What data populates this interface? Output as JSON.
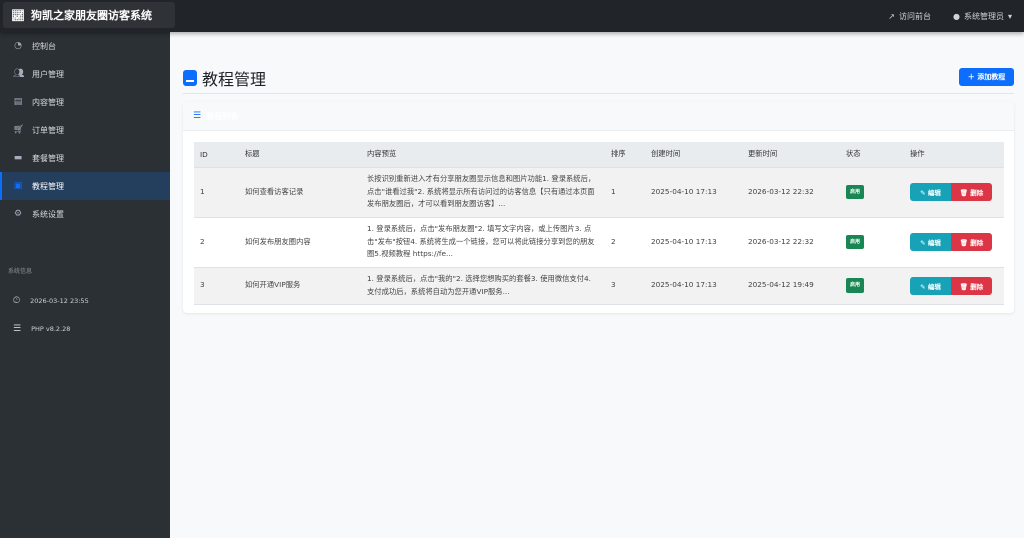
{
  "app": {
    "title": "狗凯之家朋友圈访客系统"
  },
  "navbar": {
    "visit_front": "访问前台",
    "user": "系统管理员"
  },
  "sidebar": {
    "items": [
      {
        "label": "控制台",
        "icon": "tachometer-icon"
      },
      {
        "label": "用户管理",
        "icon": "users-icon"
      },
      {
        "label": "内容管理",
        "icon": "file-icon"
      },
      {
        "label": "订单管理",
        "icon": "cart-icon"
      },
      {
        "label": "套餐管理",
        "icon": "box-icon"
      },
      {
        "label": "教程管理",
        "icon": "book-icon",
        "active": true
      },
      {
        "label": "系统设置",
        "icon": "gear-icon"
      }
    ],
    "info_heading": "系统信息",
    "time": "2026-03-12 23:55",
    "php": "PHP v8.2.28"
  },
  "page": {
    "title": "教程管理",
    "add_button": "添加教程",
    "card_title": "教程列表"
  },
  "table": {
    "headers": [
      "ID",
      "标题",
      "内容预览",
      "排序",
      "创建时间",
      "更新时间",
      "状态",
      "操作"
    ],
    "rows": [
      {
        "id": "1",
        "title": "如何查看访客记录",
        "preview": "长按识别重新进入才有分享朋友圈显示信息和图片功能1. 登录系统后，点击\"谁看过我\"2. 系统将显示所有访问过的访客信息【只有通过本页面发布朋友圈后，才可以看到朋友圈访客】...",
        "sort": "1",
        "created": "2025-04-10 17:13",
        "updated": "2026-03-12 22:32",
        "status": "启用"
      },
      {
        "id": "2",
        "title": "如何发布朋友圈内容",
        "preview": "1. 登录系统后，点击\"发布朋友圈\"2. 填写文字内容，或上传图片3. 点击\"发布\"按钮4. 系统将生成一个链接，您可以将此链接分享到您的朋友圈5.视频教程  https://fe...",
        "sort": "2",
        "created": "2025-04-10 17:13",
        "updated": "2026-03-12 22:32",
        "status": "启用"
      },
      {
        "id": "3",
        "title": "如何开通VIP服务",
        "preview": "1. 登录系统后，点击\"我的\"2. 选择您想购买的套餐3. 使用微信支付4. 支付成功后，系统将自动为您开通VIP服务...",
        "sort": "3",
        "created": "2025-04-10 17:13",
        "updated": "2025-04-12 19:49",
        "status": "启用"
      }
    ],
    "edit_label": "编辑",
    "delete_label": "删除"
  },
  "colors": {
    "primary": "#0d6efd",
    "success": "#198754",
    "info": "#17a2b8",
    "danger": "#dc3545",
    "navbar": "#212529",
    "sidebar": "#2b3035"
  }
}
